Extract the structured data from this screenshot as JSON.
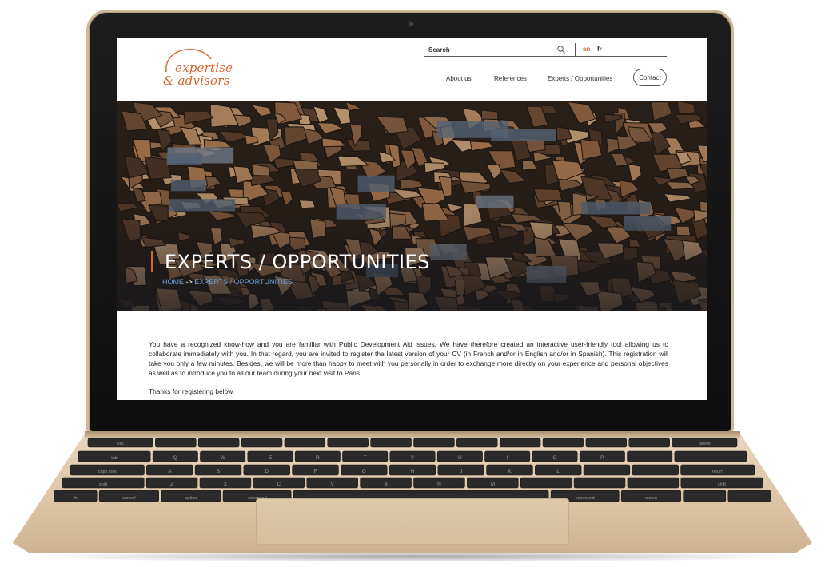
{
  "site": {
    "logo": {
      "line1": "expertise",
      "line2": "& advisors"
    },
    "search": {
      "placeholder": "Search"
    },
    "languages": {
      "active": "en",
      "other": "fr"
    },
    "nav": {
      "about": "About us",
      "references": "References",
      "experts": "Experts / Opportunities",
      "contact": "Contact"
    },
    "hero": {
      "title": "EXPERTS / OPPORTUNITIES",
      "breadcrumb": {
        "home": "HOME",
        "separator": " -> ",
        "current": "EXPERTS / OPPORTUNITIES"
      }
    },
    "content": {
      "intro": "You have a recognized know-how and you are familiar with Public Development Aid issues. We have therefore created an interactive user-friendly tool allowing us to collaborate immediately with you. In that regard, you are invited to register the latest version of your CV (in French and/or in English and/or in Spanish). This registration will take you only a few minutes. Besides, we will be more than happy to meet with you personally in order to exchange more directly on your experience and personal objectives as well as to introduce you to all our team during your next visit to Paris.",
      "thanks": "Thanks for registering below."
    },
    "colors": {
      "accent": "#d8632c",
      "link": "#6e9fd6",
      "text": "#222222"
    }
  },
  "keyboard": {
    "row1": [
      "esc",
      "",
      "",
      "",
      "",
      "",
      "",
      "",
      "",
      "",
      "",
      "",
      "",
      "delete"
    ],
    "row2": [
      "tab",
      "Q",
      "W",
      "E",
      "R",
      "T",
      "Y",
      "U",
      "I",
      "O",
      "P",
      "",
      ""
    ],
    "row3": [
      "caps lock",
      "A",
      "S",
      "D",
      "F",
      "G",
      "H",
      "J",
      "K",
      "L",
      "",
      "",
      "return"
    ],
    "row4": [
      "shift",
      "Z",
      "X",
      "C",
      "V",
      "B",
      "N",
      "M",
      "",
      "",
      "",
      "shift"
    ],
    "row5": [
      "fn",
      "control",
      "option",
      "command",
      "",
      "command",
      "option",
      "",
      ""
    ]
  }
}
